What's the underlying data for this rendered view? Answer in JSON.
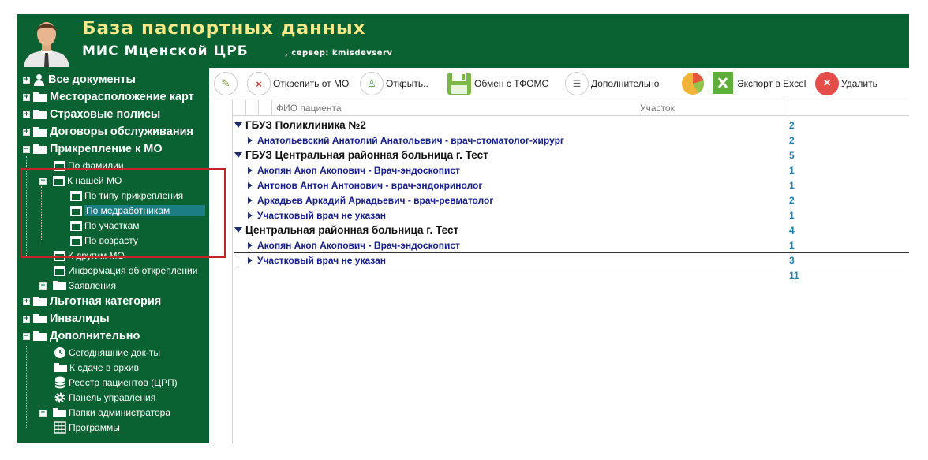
{
  "header": {
    "title": "База паспортных данных",
    "subtitle": "МИС Мценской ЦРБ",
    "server_label": ", сервер: kmisdevserv"
  },
  "sidebar": {
    "items": [
      {
        "label": "Все документы",
        "icon": "person-icon"
      },
      {
        "label": "Месторасположение карт",
        "icon": "folder-icon"
      },
      {
        "label": "Страховые полисы",
        "icon": "folder-icon"
      },
      {
        "label": "Договоры обслуживания",
        "icon": "folder-icon"
      },
      {
        "label": "Прикрепление к МО",
        "icon": "folder-icon"
      },
      {
        "label": "По фамилии",
        "icon": "window-icon"
      },
      {
        "label": "К нашей МО",
        "icon": "window-icon"
      },
      {
        "label": "По типу прикрепления",
        "icon": "window-icon"
      },
      {
        "label": "По медработникам",
        "icon": "window-icon"
      },
      {
        "label": "По участкам",
        "icon": "window-icon"
      },
      {
        "label": "По возрасту",
        "icon": "window-icon"
      },
      {
        "label": "К другим МО",
        "icon": "window-icon"
      },
      {
        "label": "Информация об откреплении",
        "icon": "window-icon"
      },
      {
        "label": "Заявления",
        "icon": "folder-icon"
      },
      {
        "label": "Льготная категория",
        "icon": "folder-icon"
      },
      {
        "label": "Инвалиды",
        "icon": "folder-icon"
      },
      {
        "label": "Дополнительно",
        "icon": "folder-icon"
      },
      {
        "label": "Сегодняшние док-ты",
        "icon": "clock-icon"
      },
      {
        "label": "К сдаче в архив",
        "icon": "folder-icon"
      },
      {
        "label": "Реестр пациентов (ЦРП)",
        "icon": "database-icon"
      },
      {
        "label": "Панель управления",
        "icon": "gear-icon"
      },
      {
        "label": "Папки администратора",
        "icon": "folder-icon"
      },
      {
        "label": "Программы",
        "icon": "grid-icon"
      }
    ]
  },
  "toolbar": {
    "detach": "Открепить от МО",
    "open": "Открыть..",
    "exchange": "Обмен с ТФОМС",
    "additional": "Дополнительно",
    "export": "Экспорт в Excel",
    "delete": "Удалить"
  },
  "grid": {
    "columns": [
      "ФИО пациента",
      "Участок"
    ],
    "rows": [
      {
        "type": "group",
        "name": "ГБУЗ Поликлиника №2",
        "count": "2"
      },
      {
        "type": "item",
        "name": "Анатольевский Анатолий Анатольевич - врач-стоматолог-хирург",
        "count": "2"
      },
      {
        "type": "group",
        "name": "ГБУЗ Центральная районная больница г. Тест",
        "count": "5"
      },
      {
        "type": "item",
        "name": "Акопян Акоп Акопович - Врач-эндоскопист",
        "count": "1"
      },
      {
        "type": "item",
        "name": "Антонов Антон Антонович - врач-эндокринолог",
        "count": "1"
      },
      {
        "type": "item",
        "name": "Аркадьев Аркадий Аркадьевич - врач-ревматолог",
        "count": "2"
      },
      {
        "type": "item",
        "name": "Участковый врач не указан",
        "count": "1"
      },
      {
        "type": "group",
        "name": "Центральная районная больница г. Тест",
        "count": "4"
      },
      {
        "type": "item",
        "name": "Акопян Акоп Акопович - Врач-эндоскопист",
        "count": "1"
      },
      {
        "type": "item",
        "name": "Участковый врач не указан",
        "count": "3"
      }
    ],
    "total": "11"
  },
  "colors": {
    "header_bg": "#0a6131",
    "title_yellow": "#f6e98a",
    "selected_bg": "#1a7e84",
    "highlight_border": "#c4252d",
    "count_blue": "#1e7fb3",
    "name_blue": "#16208a"
  }
}
